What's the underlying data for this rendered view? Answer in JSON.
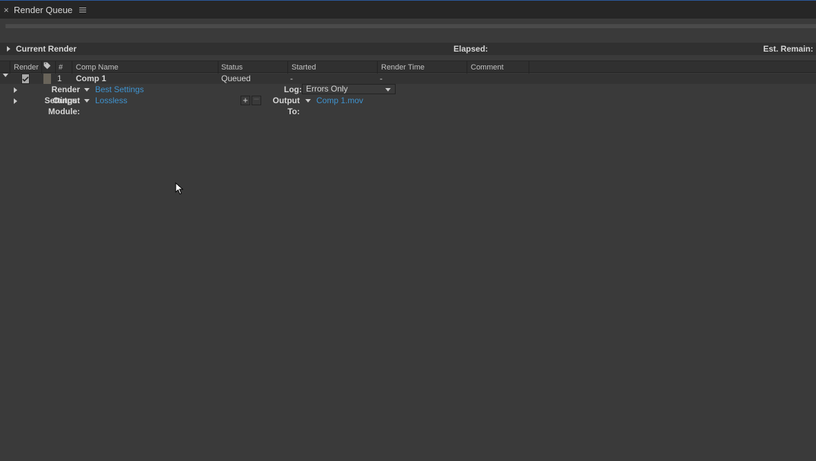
{
  "panel": {
    "title": "Render Queue"
  },
  "current_render": {
    "label": "Current Render",
    "elapsed_label": "Elapsed:",
    "remain_label": "Est. Remain:"
  },
  "columns": {
    "render": "Render",
    "hash": "#",
    "comp_name": "Comp Name",
    "status": "Status",
    "started": "Started",
    "render_time": "Render Time",
    "comment": "Comment"
  },
  "item": {
    "index": "1",
    "name": "Comp 1",
    "status": "Queued",
    "started": "-",
    "render_time": "-"
  },
  "render_settings": {
    "label": "Render Settings:",
    "value": "Best Settings"
  },
  "log": {
    "label": "Log:",
    "value": "Errors Only"
  },
  "output_module": {
    "label": "Output Module:",
    "value": "Lossless"
  },
  "output_to": {
    "label": "Output To:",
    "value": "Comp 1.mov"
  }
}
